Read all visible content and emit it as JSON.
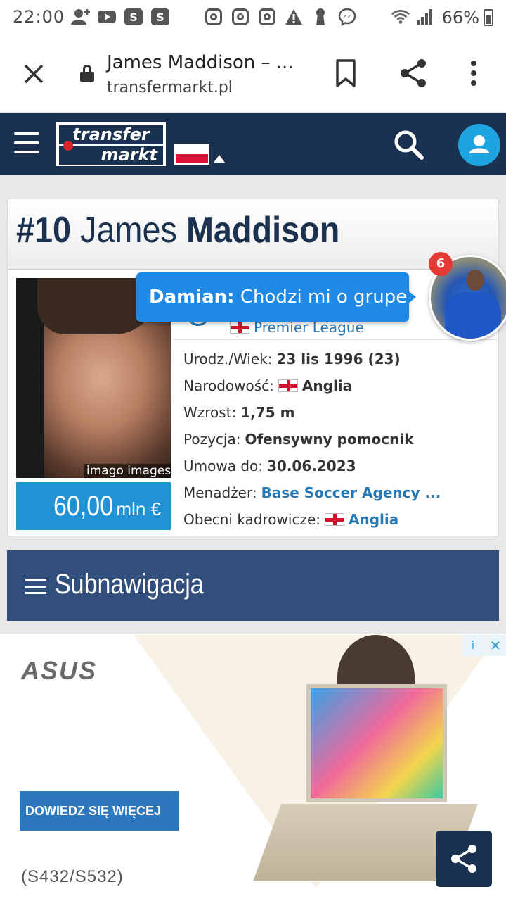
{
  "status_bar": {
    "time": "22:00",
    "battery": "66%",
    "app_icons": [
      "add-person-icon",
      "youtube-icon",
      "s-app-icon",
      "s-app-icon",
      "instagram-icon",
      "instagram-icon",
      "instagram-icon",
      "warning-icon",
      "keyhole-icon",
      "messenger-icon"
    ],
    "s_label": "S"
  },
  "browser": {
    "title": "James Maddison – ...",
    "host": "transfermarkt.pl"
  },
  "site": {
    "logo_top": "transfer",
    "logo_bottom": "markt",
    "brand_color": "#1b3150",
    "accent_color": "#1ea4e0"
  },
  "player": {
    "number": "#10",
    "first_name": "James",
    "last_name": "Maddison",
    "photo_credit": "imago images",
    "value_amount": "60,00",
    "value_unit": "mln €",
    "league": "Premier League",
    "info": [
      {
        "label": "Urodz./Wiek:",
        "value": "23 lis 1996 (23)"
      },
      {
        "label": "Narodowość:",
        "value": "Anglia"
      },
      {
        "label": "Wzrost:",
        "value": "1,75 m"
      },
      {
        "label": "Pozycja:",
        "value": "Ofensywny pomocnik"
      },
      {
        "label": "Umowa do:",
        "value": "30.06.2023"
      },
      {
        "label": "Menadżer:",
        "value": "Base Soccer Agency ..."
      },
      {
        "label": "Obecni kadrowicze:",
        "value": "Anglia"
      }
    ]
  },
  "chat": {
    "sender": "Damian:",
    "message": "Chodzi mi o grupe",
    "unread_count": "6"
  },
  "subnav": {
    "label": "Subnawigacja"
  },
  "ad": {
    "brand": "ASUS",
    "cta": "DOWIEDZ SIĘ WIĘCEJ",
    "model": "(S432/S532)",
    "info_glyph": "i",
    "close_glyph": "✕"
  }
}
